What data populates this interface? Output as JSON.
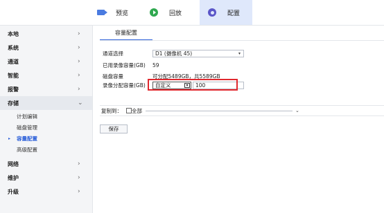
{
  "nav": {
    "tabs": [
      {
        "label": "预览",
        "icon": "camera-icon"
      },
      {
        "label": "回放",
        "icon": "play-icon"
      },
      {
        "label": "配置",
        "icon": "gear-icon",
        "active": true
      }
    ]
  },
  "sidebar": {
    "items": [
      {
        "label": "本地",
        "chevron": "›"
      },
      {
        "label": "系统",
        "chevron": "›"
      },
      {
        "label": "通道",
        "chevron": "›"
      },
      {
        "label": "智能",
        "chevron": "›"
      },
      {
        "label": "报警",
        "chevron": "›"
      },
      {
        "label": "存储",
        "chevron": "⌄",
        "expanded": true
      },
      {
        "label": "网络",
        "chevron": "›"
      },
      {
        "label": "维护",
        "chevron": "›"
      },
      {
        "label": "升级",
        "chevron": "›"
      }
    ],
    "subitems": [
      {
        "label": "计划编辑"
      },
      {
        "label": "磁盘管理"
      },
      {
        "label": "容量配置",
        "active": true,
        "marker": "▸"
      },
      {
        "label": "高级配置"
      }
    ]
  },
  "main": {
    "tab_label": "容量配置",
    "channel": {
      "label": "通道选择",
      "value": "D1 (摄像机 45)",
      "caret": "▾"
    },
    "used": {
      "label": "已用录像容量(GB)",
      "value": "59"
    },
    "disk": {
      "label": "磁盘容量",
      "value": "可分配5489GB，共5589GB"
    },
    "alloc": {
      "label": "录像分配容量(GB)",
      "mode": "自定义",
      "caret": "▾",
      "value": "100"
    },
    "copy": {
      "label": "复制到：",
      "all_label": "全部",
      "caret": "⌄"
    },
    "save_label": "保存"
  },
  "colors": {
    "accent": "#2b5fd9",
    "highlight_box": "#e0282e",
    "active_tab_bg": "#dfe8fb"
  }
}
